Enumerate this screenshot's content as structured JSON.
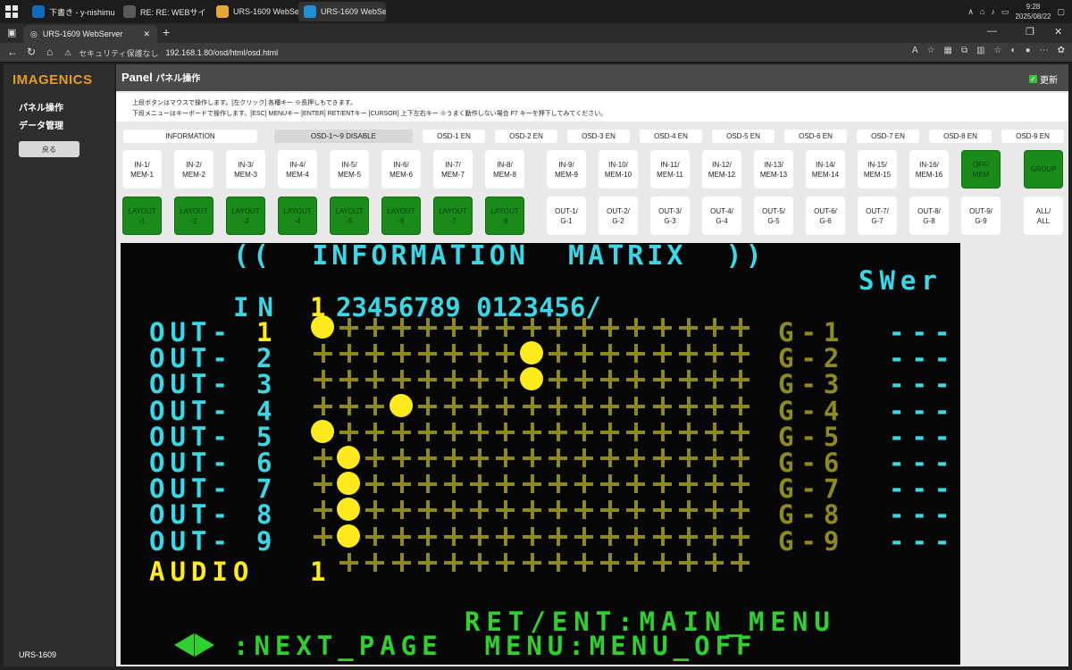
{
  "taskbar": {
    "tasks": [
      {
        "label": "下書き - y-nishimur...",
        "color": "#0f6cbd"
      },
      {
        "label": "RE: RE: WEBサイト更...",
        "color": "#5a5a5a"
      },
      {
        "label": "URS-1609 WebServ...",
        "color": "#e8a53a"
      },
      {
        "label": "URS-1609 WebServ...",
        "color": "#1f8fd6"
      }
    ],
    "time": "9:28",
    "date": "2025/08/22"
  },
  "browser": {
    "tab_title": "URS-1609 WebServer",
    "security_label": "セキュリティ保護なし",
    "url": "192.168.1.80/osd/html/osd.html"
  },
  "sidebar": {
    "logo": "IMAGENICS",
    "menu": [
      "パネル操作",
      "データ管理"
    ],
    "back_button": "戻る",
    "model": "URS-1609"
  },
  "header": {
    "title": "Panel",
    "subtitle": "パネル操作",
    "refresh_label": "更新",
    "refresh_checked": true
  },
  "notes": [
    "上段ボタンはマウスで操作します。[左クリック] 各種キー ※長押しもできます。",
    "下段メニューはキーボードで操作します。[ESC] MENUキー [ENTER] RET/ENTキー [CURSOR] 上下左右キー ※うまく動作しない場合 F7 キーを押下してみてください。"
  ],
  "osd_buttons": [
    "INFORMATION",
    "OSD-1～9 DISABLE",
    "OSD-1 EN",
    "OSD-2 EN",
    "OSD-3 EN",
    "OSD-4 EN",
    "OSD-5 EN",
    "OSD-6 EN",
    "OSD-7 EN",
    "OSD-8 EN",
    "OSD-9 EN"
  ],
  "row1_buttons": [
    "IN-1/\nMEM-1",
    "IN-2/\nMEM-2",
    "IN-3/\nMEM-3",
    "IN-4/\nMEM-4",
    "IN-5/\nMEM-5",
    "IN-6/\nMEM-6",
    "IN-7/\nMEM-7",
    "IN-8/\nMEM-8",
    "IN-9/\nMEM-9",
    "IN-10/\nMEM-10",
    "IN-11/\nMEM-11",
    "IN-12/\nMEM-12",
    "IN-13/\nMEM-13",
    "IN-14/\nMEM-14",
    "IN-15/\nMEM-15",
    "IN-16/\nMEM-16",
    "OFF/\nMEM",
    "GROUP"
  ],
  "row2_buttons": [
    "LAYOUT\n-1",
    "LAYOUT\n-2",
    "LAYOUT\n-3",
    "LAYOUT\n-4",
    "LAYOUT\n-5",
    "LAYOUT\n-6",
    "LAYOUT\n-7",
    "LAYOUT\n-8",
    "OUT-1/\nG-1",
    "OUT-2/\nG-2",
    "OUT-3/\nG-3",
    "OUT-4/\nG-4",
    "OUT-5/\nG-5",
    "OUT-6/\nG-6",
    "OUT-7/\nG-7",
    "OUT-8/\nG-8",
    "OUT-9/\nG-9",
    "ALL/\nALL"
  ],
  "osd": {
    "title": "((  INFORMATION  MATRIX  ))",
    "swer": "SWer",
    "in_label": "IN",
    "first_col": "1",
    "col_labels": "23456789 0123456/",
    "rows": [
      {
        "label": "OUT-",
        "num": "1",
        "group": "G-1",
        "dash": "---"
      },
      {
        "label": "OUT-",
        "num": "2",
        "group": "G-2",
        "dash": "---"
      },
      {
        "label": "OUT-",
        "num": "3",
        "group": "G-3",
        "dash": "---"
      },
      {
        "label": "OUT-",
        "num": "4",
        "group": "G-4",
        "dash": "---"
      },
      {
        "label": "OUT-",
        "num": "5",
        "group": "G-5",
        "dash": "---"
      },
      {
        "label": "OUT-",
        "num": "6",
        "group": "G-6",
        "dash": "---"
      },
      {
        "label": "OUT-",
        "num": "7",
        "group": "G-7",
        "dash": "---"
      },
      {
        "label": "OUT-",
        "num": "8",
        "group": "G-8",
        "dash": "---"
      },
      {
        "label": "OUT-",
        "num": "9",
        "group": "G-9",
        "dash": "---"
      }
    ],
    "audio_label": "AUDIO",
    "audio_num": "1",
    "routes": [
      [
        0,
        0
      ],
      [
        1,
        8
      ],
      [
        2,
        8
      ],
      [
        3,
        3
      ],
      [
        4,
        0
      ],
      [
        5,
        1
      ],
      [
        6,
        1
      ],
      [
        7,
        1
      ],
      [
        8,
        1
      ]
    ],
    "footer1": "RET/ENT:MAIN_MENU",
    "footer2": ":NEXT_PAGE  MENU:MENU_OFF"
  }
}
